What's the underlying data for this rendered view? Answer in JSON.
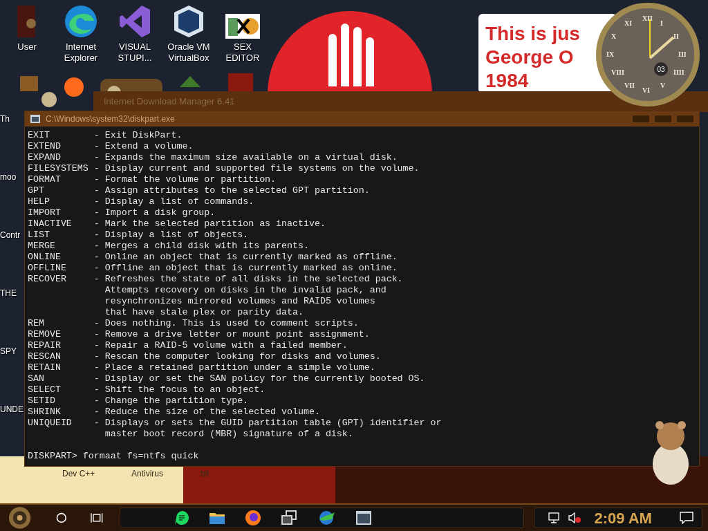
{
  "desktop_icons": [
    {
      "label": "User",
      "kind": "user"
    },
    {
      "label": "Internet\nExplorer",
      "kind": "browser"
    },
    {
      "label": "VISUAL\nSTUPI...",
      "kind": "ide"
    },
    {
      "label": "Oracle VM\nVirtualBox",
      "kind": "vm"
    },
    {
      "label": "SEX\nEDITOR",
      "kind": "hex"
    }
  ],
  "left_labels": [
    "Th",
    "moo",
    "Contr",
    "THE",
    "SPY",
    "UNDE"
  ],
  "note": {
    "lines": [
      "This is jus",
      "George O",
      "1984"
    ]
  },
  "clock": {
    "numerals": [
      "XII",
      "I",
      "II",
      "III",
      "IIII",
      "V",
      "VI",
      "VII",
      "VIII",
      "IX",
      "X",
      "XI"
    ],
    "date": "03"
  },
  "back_window": {
    "title": "Internet Download Manager 6.41"
  },
  "console": {
    "title": "C:\\Windows\\system32\\diskpart.exe",
    "lines": [
      "EXIT        - Exit DiskPart.",
      "EXTEND      - Extend a volume.",
      "EXPAND      - Expands the maximum size available on a virtual disk.",
      "FILESYSTEMS - Display current and supported file systems on the volume.",
      "FORMAT      - Format the volume or partition.",
      "GPT         - Assign attributes to the selected GPT partition.",
      "HELP        - Display a list of commands.",
      "IMPORT      - Import a disk group.",
      "INACTIVE    - Mark the selected partition as inactive.",
      "LIST        - Display a list of objects.",
      "MERGE       - Merges a child disk with its parents.",
      "ONLINE      - Online an object that is currently marked as offline.",
      "OFFLINE     - Offline an object that is currently marked as online.",
      "RECOVER     - Refreshes the state of all disks in the selected pack.",
      "              Attempts recovery on disks in the invalid pack, and",
      "              resynchronizes mirrored volumes and RAID5 volumes",
      "              that have stale plex or parity data.",
      "REM         - Does nothing. This is used to comment scripts.",
      "REMOVE      - Remove a drive letter or mount point assignment.",
      "REPAIR      - Repair a RAID-5 volume with a failed member.",
      "RESCAN      - Rescan the computer looking for disks and volumes.",
      "RETAIN      - Place a retained partition under a simple volume.",
      "SAN         - Display or set the SAN policy for the currently booted OS.",
      "SELECT      - Shift the focus to an object.",
      "SETID       - Change the partition type.",
      "SHRINK      - Reduce the size of the selected volume.",
      "UNIQUEID    - Displays or sets the GUID partition table (GPT) identifier or",
      "              master boot record (MBR) signature of a disk."
    ],
    "prompt": "DISKPART> formaat fs=ntfs quick"
  },
  "bottom_labels": [
    "Dev C++",
    "Antivirus",
    "bit"
  ],
  "taskbar": {
    "pinned": [
      {
        "kind": "chat"
      },
      {
        "kind": "folder"
      },
      {
        "kind": "firefox"
      },
      {
        "kind": "windows"
      },
      {
        "kind": "globe"
      },
      {
        "kind": "terminal"
      }
    ],
    "tray": {
      "volume_muted": true,
      "time": "2:09 AM"
    }
  }
}
